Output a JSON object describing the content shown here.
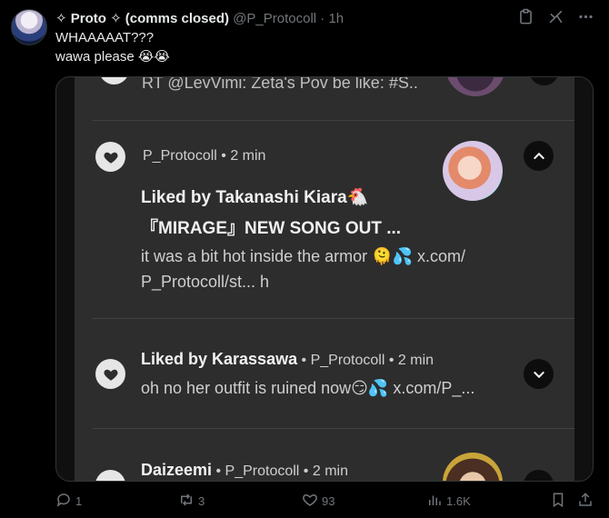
{
  "post": {
    "display_name": "✧ Proto ✧ (comms closed)",
    "handle": "@P_Protocoll",
    "time": "· 1h",
    "line1": "WHAAAAAT???",
    "line2": "wawa please 😭😭"
  },
  "embed": {
    "top_snippet": "RT @LevVimi: Zeta's Pov be like: #S..",
    "notif1": {
      "meta": "P_Protocoll • 2 min",
      "title1": "Liked by Takanashi Kiara🐔",
      "title2": "『MIRAGE』NEW SONG OUT ...",
      "body1": "it was a bit hot inside the armor 🫠💦 x.com/",
      "body2": "P_Protocoll/st... h"
    },
    "notif2": {
      "title": "Liked by Karassawa",
      "meta": " • P_Protocoll • 2 min",
      "body": "oh no her outfit is ruined now😏💦 x.com/P_..."
    },
    "notif3": {
      "title": "Daizeemi",
      "meta": " • P_Protocoll • 2 min"
    }
  },
  "actions": {
    "replies": "1",
    "reposts": "3",
    "likes": "93",
    "views": "1.6K"
  },
  "colors": {
    "background": "#000000",
    "screen": "#2d2d2d",
    "muted": "#71767b"
  }
}
